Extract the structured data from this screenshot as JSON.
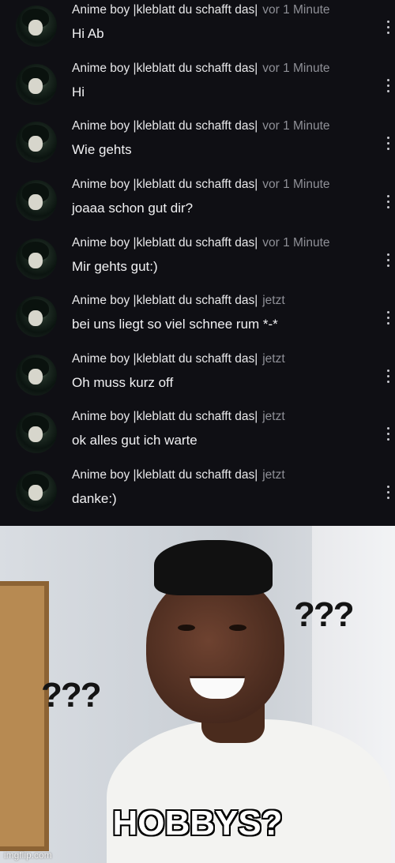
{
  "chat": {
    "messages": [
      {
        "author": "Anime boy |kleblatt du schafft das|",
        "time": "vor 1 Minute",
        "text": "Hi Ab"
      },
      {
        "author": "Anime boy |kleblatt du schafft das|",
        "time": "vor 1 Minute",
        "text": "Hi"
      },
      {
        "author": "Anime boy |kleblatt du schafft das|",
        "time": "vor 1 Minute",
        "text": "Wie gehts"
      },
      {
        "author": "Anime boy |kleblatt du schafft das|",
        "time": "vor 1 Minute",
        "text": "joaaa schon gut dir?"
      },
      {
        "author": "Anime boy |kleblatt du schafft das|",
        "time": "vor 1 Minute",
        "text": "Mir gehts gut:)"
      },
      {
        "author": "Anime boy |kleblatt du schafft das|",
        "time": "jetzt",
        "text": "bei uns liegt so viel schnee rum *-*"
      },
      {
        "author": "Anime boy |kleblatt du schafft das|",
        "time": "jetzt",
        "text": "Oh muss kurz off"
      },
      {
        "author": "Anime boy |kleblatt du schafft das|",
        "time": "jetzt",
        "text": "ok alles gut ich warte"
      },
      {
        "author": "Anime boy |kleblatt du schafft das|",
        "time": "jetzt",
        "text": "danke:)"
      }
    ]
  },
  "meme": {
    "question_marks_left": "???",
    "question_marks_right": "???",
    "caption": "HOBBYS?",
    "watermark": "imgflip.com"
  },
  "colors": {
    "chat_background": "#0f0f14",
    "author_text": "#e8e8ea",
    "time_text": "#8f9097"
  }
}
